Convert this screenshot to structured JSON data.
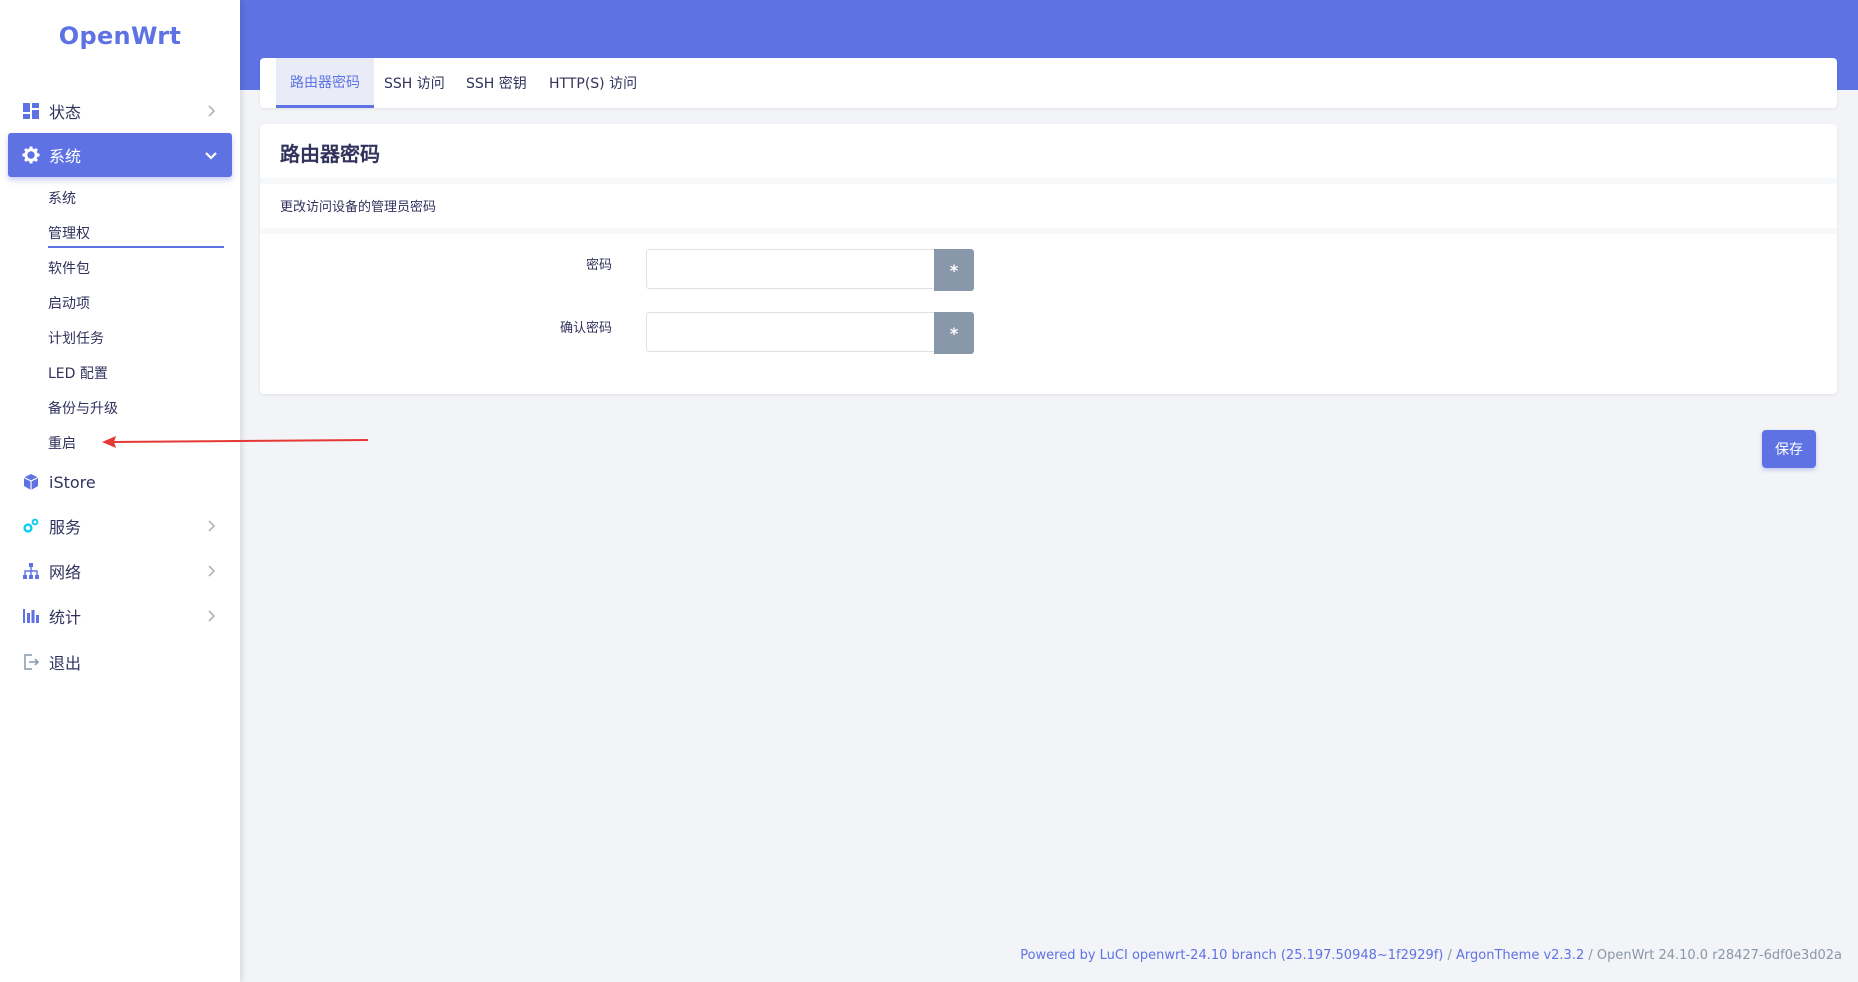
{
  "brand": {
    "logo_text": "OpenWrt"
  },
  "sidebar": {
    "items": [
      {
        "label": "状态",
        "icon": "dashboard-icon"
      },
      {
        "label": "系统",
        "icon": "gear-icon"
      },
      {
        "label": "iStore",
        "icon": "cube-icon"
      },
      {
        "label": "服务",
        "icon": "cogs-icon"
      },
      {
        "label": "网络",
        "icon": "sitemap-icon"
      },
      {
        "label": "统计",
        "icon": "bar-chart-icon"
      },
      {
        "label": "退出",
        "icon": "sign-out-icon"
      }
    ],
    "system_subitems": [
      {
        "label": "系统"
      },
      {
        "label": "管理权"
      },
      {
        "label": "软件包"
      },
      {
        "label": "启动项"
      },
      {
        "label": "计划任务"
      },
      {
        "label": "LED 配置"
      },
      {
        "label": "备份与升级"
      },
      {
        "label": "重启"
      }
    ]
  },
  "tabs": [
    {
      "label": "路由器密码",
      "active": true
    },
    {
      "label": "SSH 访问",
      "active": false
    },
    {
      "label": "SSH 密钥",
      "active": false
    },
    {
      "label": "HTTP(S) 访问",
      "active": false
    }
  ],
  "main": {
    "title": "路由器密码",
    "description": "更改访问设备的管理员密码",
    "fields": [
      {
        "label": "密码",
        "value": "",
        "reveal_label": "*"
      },
      {
        "label": "确认密码",
        "value": "",
        "reveal_label": "*"
      }
    ]
  },
  "actions": {
    "save_label": "保存"
  },
  "footer": {
    "powered_prefix": "Powered by ",
    "luci_link": "LuCI openwrt-24.10 branch (25.197.50948~1f2929f)",
    "sep1": " / ",
    "theme_link": "ArgonTheme v2.3.2",
    "sep2": " / ",
    "version": "OpenWrt 24.10.0 r28427-6df0e3d02a"
  },
  "colors": {
    "accent": "#5e72e4",
    "header": "#5e72e4",
    "muted_button": "#8898aa",
    "annotation_arrow": "#e53935"
  }
}
